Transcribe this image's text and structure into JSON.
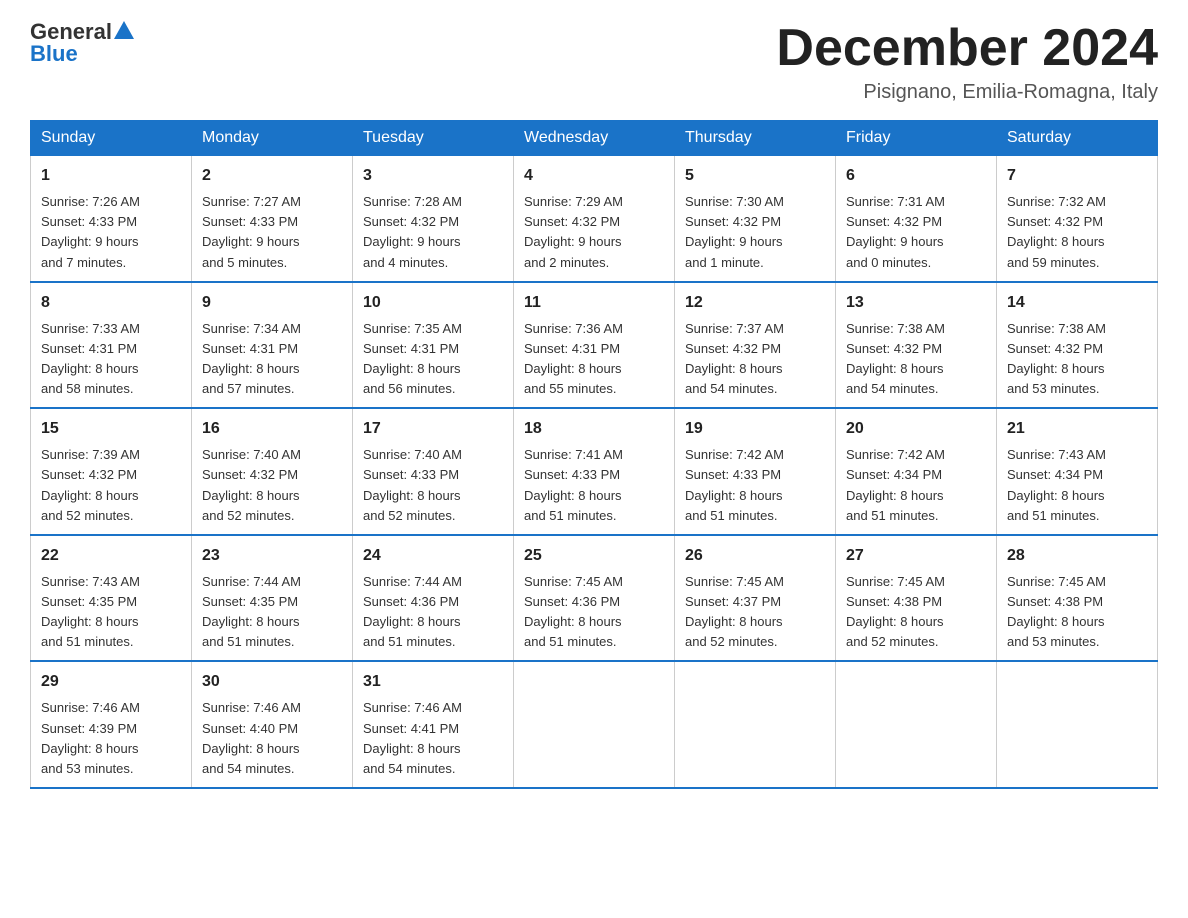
{
  "header": {
    "logo_line1": "General",
    "logo_line2": "Blue",
    "month_year": "December 2024",
    "location": "Pisignano, Emilia-Romagna, Italy"
  },
  "days_of_week": [
    "Sunday",
    "Monday",
    "Tuesday",
    "Wednesday",
    "Thursday",
    "Friday",
    "Saturday"
  ],
  "weeks": [
    [
      {
        "day": "1",
        "sunrise": "7:26 AM",
        "sunset": "4:33 PM",
        "daylight": "9 hours and 7 minutes."
      },
      {
        "day": "2",
        "sunrise": "7:27 AM",
        "sunset": "4:33 PM",
        "daylight": "9 hours and 5 minutes."
      },
      {
        "day": "3",
        "sunrise": "7:28 AM",
        "sunset": "4:32 PM",
        "daylight": "9 hours and 4 minutes."
      },
      {
        "day": "4",
        "sunrise": "7:29 AM",
        "sunset": "4:32 PM",
        "daylight": "9 hours and 2 minutes."
      },
      {
        "day": "5",
        "sunrise": "7:30 AM",
        "sunset": "4:32 PM",
        "daylight": "9 hours and 1 minute."
      },
      {
        "day": "6",
        "sunrise": "7:31 AM",
        "sunset": "4:32 PM",
        "daylight": "9 hours and 0 minutes."
      },
      {
        "day": "7",
        "sunrise": "7:32 AM",
        "sunset": "4:32 PM",
        "daylight": "8 hours and 59 minutes."
      }
    ],
    [
      {
        "day": "8",
        "sunrise": "7:33 AM",
        "sunset": "4:31 PM",
        "daylight": "8 hours and 58 minutes."
      },
      {
        "day": "9",
        "sunrise": "7:34 AM",
        "sunset": "4:31 PM",
        "daylight": "8 hours and 57 minutes."
      },
      {
        "day": "10",
        "sunrise": "7:35 AM",
        "sunset": "4:31 PM",
        "daylight": "8 hours and 56 minutes."
      },
      {
        "day": "11",
        "sunrise": "7:36 AM",
        "sunset": "4:31 PM",
        "daylight": "8 hours and 55 minutes."
      },
      {
        "day": "12",
        "sunrise": "7:37 AM",
        "sunset": "4:32 PM",
        "daylight": "8 hours and 54 minutes."
      },
      {
        "day": "13",
        "sunrise": "7:38 AM",
        "sunset": "4:32 PM",
        "daylight": "8 hours and 54 minutes."
      },
      {
        "day": "14",
        "sunrise": "7:38 AM",
        "sunset": "4:32 PM",
        "daylight": "8 hours and 53 minutes."
      }
    ],
    [
      {
        "day": "15",
        "sunrise": "7:39 AM",
        "sunset": "4:32 PM",
        "daylight": "8 hours and 52 minutes."
      },
      {
        "day": "16",
        "sunrise": "7:40 AM",
        "sunset": "4:32 PM",
        "daylight": "8 hours and 52 minutes."
      },
      {
        "day": "17",
        "sunrise": "7:40 AM",
        "sunset": "4:33 PM",
        "daylight": "8 hours and 52 minutes."
      },
      {
        "day": "18",
        "sunrise": "7:41 AM",
        "sunset": "4:33 PM",
        "daylight": "8 hours and 51 minutes."
      },
      {
        "day": "19",
        "sunrise": "7:42 AM",
        "sunset": "4:33 PM",
        "daylight": "8 hours and 51 minutes."
      },
      {
        "day": "20",
        "sunrise": "7:42 AM",
        "sunset": "4:34 PM",
        "daylight": "8 hours and 51 minutes."
      },
      {
        "day": "21",
        "sunrise": "7:43 AM",
        "sunset": "4:34 PM",
        "daylight": "8 hours and 51 minutes."
      }
    ],
    [
      {
        "day": "22",
        "sunrise": "7:43 AM",
        "sunset": "4:35 PM",
        "daylight": "8 hours and 51 minutes."
      },
      {
        "day": "23",
        "sunrise": "7:44 AM",
        "sunset": "4:35 PM",
        "daylight": "8 hours and 51 minutes."
      },
      {
        "day": "24",
        "sunrise": "7:44 AM",
        "sunset": "4:36 PM",
        "daylight": "8 hours and 51 minutes."
      },
      {
        "day": "25",
        "sunrise": "7:45 AM",
        "sunset": "4:36 PM",
        "daylight": "8 hours and 51 minutes."
      },
      {
        "day": "26",
        "sunrise": "7:45 AM",
        "sunset": "4:37 PM",
        "daylight": "8 hours and 52 minutes."
      },
      {
        "day": "27",
        "sunrise": "7:45 AM",
        "sunset": "4:38 PM",
        "daylight": "8 hours and 52 minutes."
      },
      {
        "day": "28",
        "sunrise": "7:45 AM",
        "sunset": "4:38 PM",
        "daylight": "8 hours and 53 minutes."
      }
    ],
    [
      {
        "day": "29",
        "sunrise": "7:46 AM",
        "sunset": "4:39 PM",
        "daylight": "8 hours and 53 minutes."
      },
      {
        "day": "30",
        "sunrise": "7:46 AM",
        "sunset": "4:40 PM",
        "daylight": "8 hours and 54 minutes."
      },
      {
        "day": "31",
        "sunrise": "7:46 AM",
        "sunset": "4:41 PM",
        "daylight": "8 hours and 54 minutes."
      },
      null,
      null,
      null,
      null
    ]
  ],
  "labels": {
    "sunrise": "Sunrise:",
    "sunset": "Sunset:",
    "daylight": "Daylight:"
  }
}
